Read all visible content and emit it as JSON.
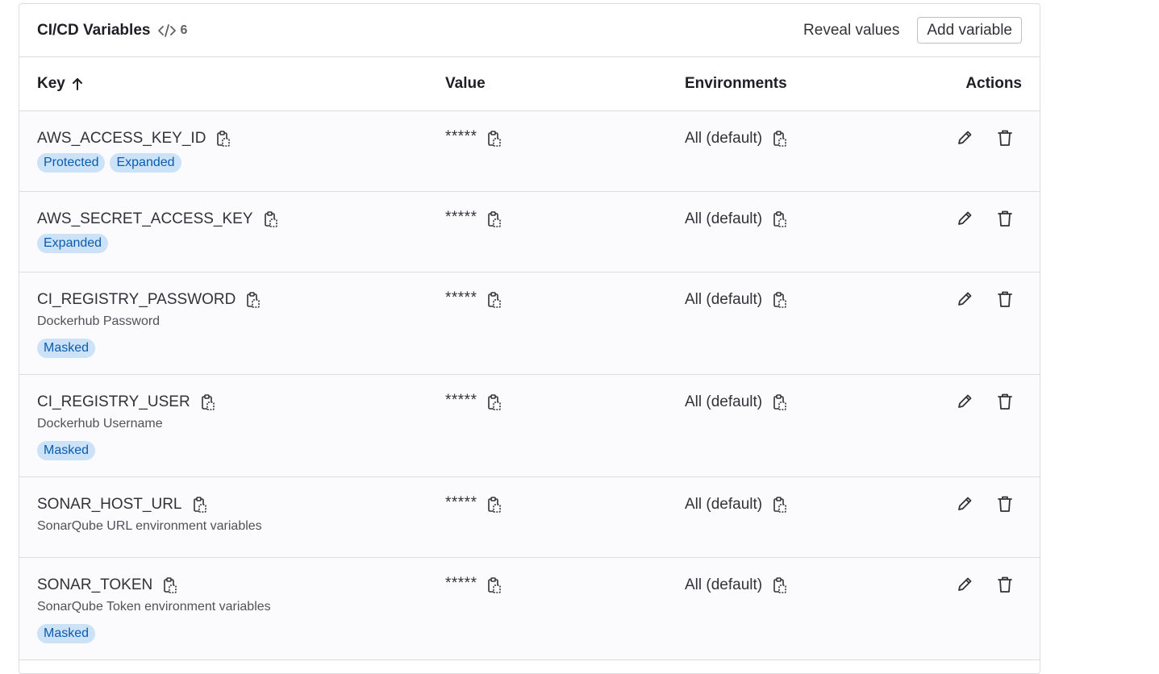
{
  "header": {
    "title": "CI/CD Variables",
    "count": "6",
    "reveal_label": "Reveal values",
    "add_label": "Add variable"
  },
  "columns": {
    "key": "Key",
    "value": "Value",
    "environments": "Environments",
    "actions": "Actions"
  },
  "variables": [
    {
      "key": "AWS_ACCESS_KEY_ID",
      "value": "*****",
      "environment": "All (default)",
      "description": "",
      "badges": [
        "Protected",
        "Expanded"
      ]
    },
    {
      "key": "AWS_SECRET_ACCESS_KEY",
      "value": "*****",
      "environment": "All (default)",
      "description": "",
      "badges": [
        "Expanded"
      ]
    },
    {
      "key": "CI_REGISTRY_PASSWORD",
      "value": "*****",
      "environment": "All (default)",
      "description": "Dockerhub Password",
      "badges": [
        "Masked"
      ]
    },
    {
      "key": "CI_REGISTRY_USER",
      "value": "*****",
      "environment": "All (default)",
      "description": "Dockerhub Username",
      "badges": [
        "Masked"
      ]
    },
    {
      "key": "SONAR_HOST_URL",
      "value": "*****",
      "environment": "All (default)",
      "description": "SonarQube URL environment variables",
      "badges": []
    },
    {
      "key": "SONAR_TOKEN",
      "value": "*****",
      "environment": "All (default)",
      "description": "SonarQube Token environment variables",
      "badges": [
        "Masked"
      ]
    }
  ],
  "icons": {
    "count_icon": "code-icon",
    "sort_icon": "arrow-up-icon",
    "copy_icon": "copy-clipboard-icon",
    "edit_icon": "pencil-icon",
    "delete_icon": "trash-icon"
  },
  "colors": {
    "badge_bg": "#cbe2f9",
    "badge_text": "#0b5cad",
    "row_bg": "#fbfafd",
    "border": "#dcdcde"
  }
}
